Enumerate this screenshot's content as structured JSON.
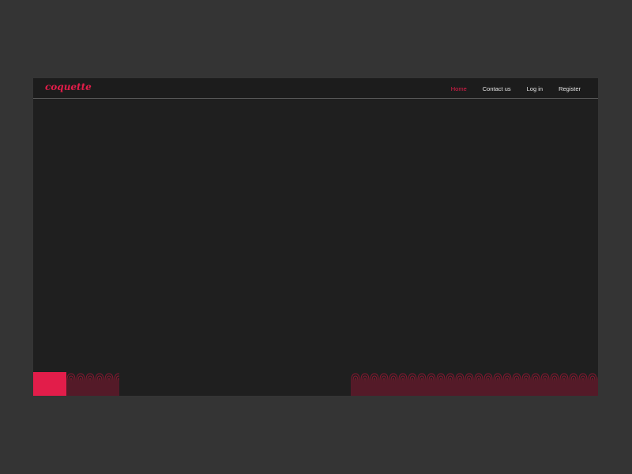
{
  "site": {
    "logo": "coquette"
  },
  "nav": {
    "items": [
      {
        "label": "Home",
        "active": true
      },
      {
        "label": "Contact us",
        "active": false
      },
      {
        "label": "Log in",
        "active": false
      },
      {
        "label": "Register",
        "active": false
      }
    ]
  },
  "colors": {
    "page_background": "#343434",
    "site_background": "#1f1f1f",
    "accent": "#e21d4a",
    "nav_text": "#e6e6e6"
  }
}
